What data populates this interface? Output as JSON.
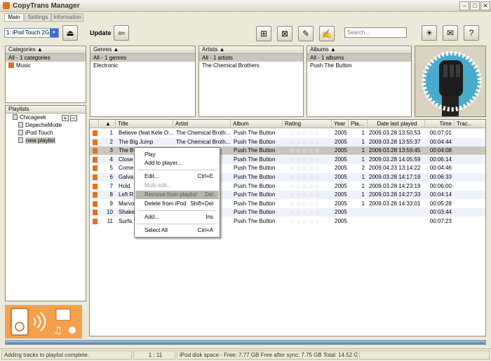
{
  "window": {
    "title": "CopyTrans Manager"
  },
  "tabs": [
    "Main",
    "Settings",
    "Information"
  ],
  "toolbar": {
    "device": "1: iPod Touch 2G",
    "update_label": "Update",
    "search_placeholder": "Search..."
  },
  "categories": {
    "header": "Categories",
    "items": [
      "All - 1 categories",
      "Music"
    ]
  },
  "genres": {
    "header": "Genres",
    "items": [
      "All - 1 genres",
      "Electronic"
    ]
  },
  "artists": {
    "header": "Artists",
    "items": [
      "All - 1 artists",
      "The Chemical Brothers"
    ]
  },
  "albums": {
    "header": "Albums",
    "items": [
      "All - 1 albums",
      "Push The Button"
    ]
  },
  "playlists": {
    "header": "Playlists",
    "items": [
      "Chicageek",
      "DepecheMode",
      "iPod Touch",
      "new playlist"
    ]
  },
  "table": {
    "columns": [
      "Title",
      "Artist",
      "Album",
      "Rating",
      "Year",
      "Pla...",
      "Date last played",
      "Time",
      "Trac..."
    ],
    "rows": [
      {
        "n": "1",
        "title": "Believe (feat Kele O...",
        "artist": "The Chemical Broth...",
        "album": "Push The Button",
        "year": "2005",
        "plays": "1",
        "date": "2009.03.28 13:50:53",
        "time": "00:07:01"
      },
      {
        "n": "2",
        "title": "The Big Jump",
        "artist": "The Chemical Broth...",
        "album": "Push The Button",
        "year": "2005",
        "plays": "1",
        "date": "2009.03.28 13:55:37",
        "time": "00:04:44"
      },
      {
        "n": "3",
        "title": "The B",
        "artist": "",
        "album": "Push The Button",
        "year": "2005",
        "plays": "1",
        "date": "2009.03.28 13:59:45",
        "time": "00:04:08"
      },
      {
        "n": "4",
        "title": "Close",
        "artist": "",
        "album": "Push The Button",
        "year": "2005",
        "plays": "1",
        "date": "2009.03.28 14:05:59",
        "time": "00:06:14"
      },
      {
        "n": "5",
        "title": "Come",
        "artist": "",
        "album": "Push The Button",
        "year": "2005",
        "plays": "2",
        "date": "2009.04.23 13:14:22",
        "time": "00:04:46"
      },
      {
        "n": "6",
        "title": "Galva",
        "artist": "",
        "album": "Push The Button",
        "year": "2005",
        "plays": "1",
        "date": "2009.03.28 14:17:19",
        "time": "00:06:33"
      },
      {
        "n": "7",
        "title": "Hold",
        "artist": "",
        "album": "Push The Button",
        "year": "2005",
        "plays": "1",
        "date": "2009.03.28 14:23:19",
        "time": "00:06:00"
      },
      {
        "n": "8",
        "title": "Left R",
        "artist": "",
        "album": "Push The Button",
        "year": "2005",
        "plays": "1",
        "date": "2009.03.28 14:27:33",
        "time": "00:04:14"
      },
      {
        "n": "9",
        "title": "Marvo",
        "artist": "",
        "album": "Push The Button",
        "year": "2005",
        "plays": "1",
        "date": "2009.03.28 14:33:01",
        "time": "00:05:28"
      },
      {
        "n": "10",
        "title": "Shake",
        "artist": "",
        "album": "Push The Button",
        "year": "2005",
        "plays": "",
        "date": "",
        "time": "00:03:44"
      },
      {
        "n": "11",
        "title": "Surfa",
        "artist": "",
        "album": "Push The Button",
        "year": "2005",
        "plays": "",
        "date": "",
        "time": "00:07:23"
      }
    ]
  },
  "context_menu": [
    {
      "label": "Play",
      "shortcut": ""
    },
    {
      "label": "Add to player...",
      "shortcut": ""
    },
    {
      "label": "Edit...",
      "shortcut": "Ctrl+E"
    },
    {
      "label": "Multi edit...",
      "shortcut": ""
    },
    {
      "label": "Remove from playlist",
      "shortcut": "Del"
    },
    {
      "label": "Delete from iPod",
      "shortcut": "Shift+Del"
    },
    {
      "label": "Add...",
      "shortcut": "Ins"
    },
    {
      "label": "Select All",
      "shortcut": "Ctrl+A"
    }
  ],
  "status": {
    "message": "Adding tracks to playlist complete.",
    "counter": "1 : 11",
    "disk": "iPod disk space - Free: 7.77 GB Free after sync: 7.75 GB Total: 14.52 GB",
    "progress": 100
  }
}
